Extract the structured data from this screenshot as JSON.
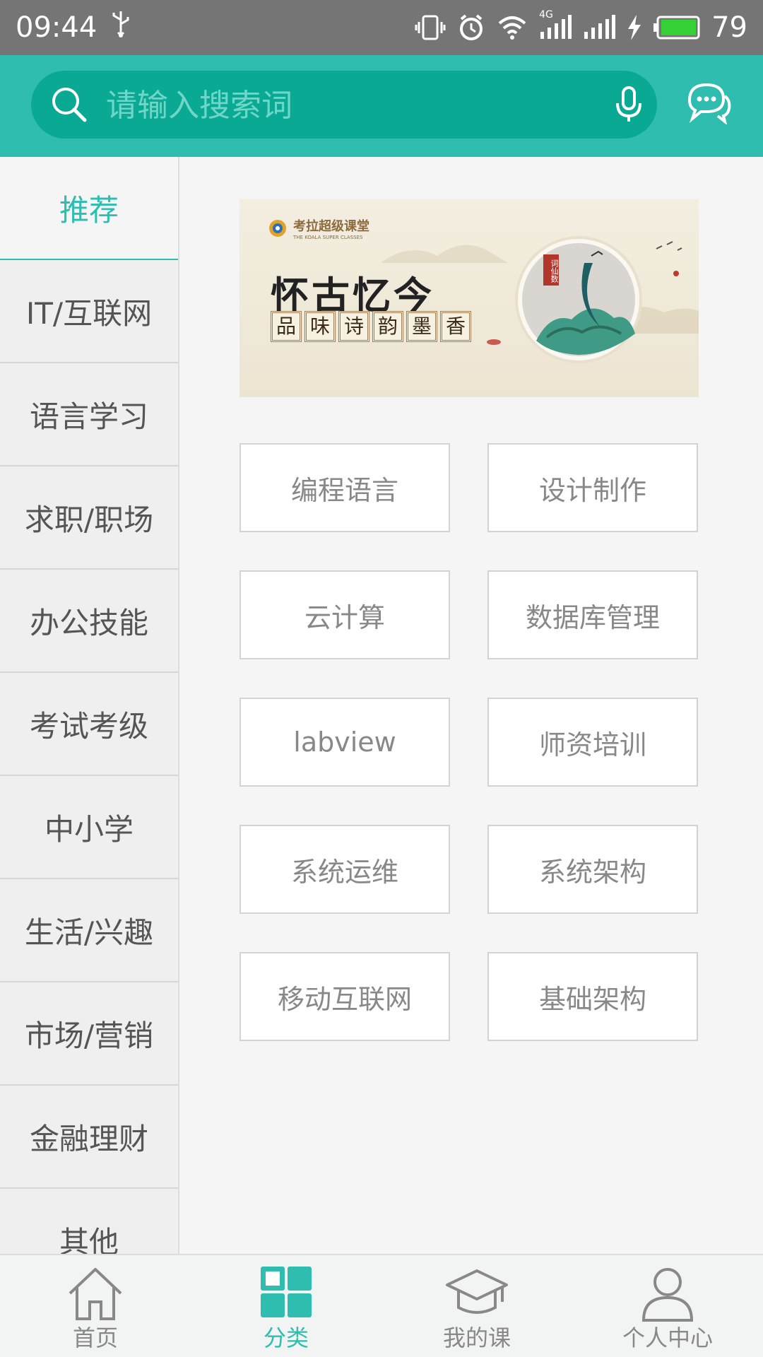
{
  "status_bar": {
    "time": "09:44",
    "battery": "79",
    "network": "4G",
    "icons": [
      "usb-icon",
      "vibrate-icon",
      "alarm-icon",
      "wifi-icon",
      "signal-icon",
      "signal-icon",
      "charging-icon",
      "battery-icon"
    ]
  },
  "search": {
    "placeholder": "请输入搜索词",
    "value": ""
  },
  "sidebar": {
    "items": [
      {
        "label": "推荐",
        "active": true
      },
      {
        "label": "IT/互联网"
      },
      {
        "label": "语言学习"
      },
      {
        "label": "求职/职场"
      },
      {
        "label": "办公技能"
      },
      {
        "label": "考试考级"
      },
      {
        "label": "中小学"
      },
      {
        "label": "生活/兴趣"
      },
      {
        "label": "市场/营销"
      },
      {
        "label": "金融理财"
      },
      {
        "label": "其他"
      }
    ]
  },
  "banner": {
    "logo_text": "考拉超级课堂",
    "logo_subtext": "THE KOALA SUPER CLASSES",
    "title": "怀古忆今",
    "subtitle_chars": [
      "品",
      "味",
      "诗",
      "韵",
      "墨",
      "香"
    ],
    "seal_text": "词仙数"
  },
  "categories": [
    "编程语言",
    "设计制作",
    "云计算",
    "数据库管理",
    "labview",
    "师资培训",
    "系统运维",
    "系统架构",
    "移动互联网",
    "基础架构"
  ],
  "bottom_nav": {
    "items": [
      {
        "label": "首页",
        "icon": "home-icon"
      },
      {
        "label": "分类",
        "icon": "category-grid-icon",
        "active": true
      },
      {
        "label": "我的课",
        "icon": "graduation-cap-icon"
      },
      {
        "label": "个人中心",
        "icon": "person-icon"
      }
    ]
  },
  "colors": {
    "accent": "#2ebdaf",
    "search_bg": "#0aa993",
    "status_bar": "#757575"
  }
}
